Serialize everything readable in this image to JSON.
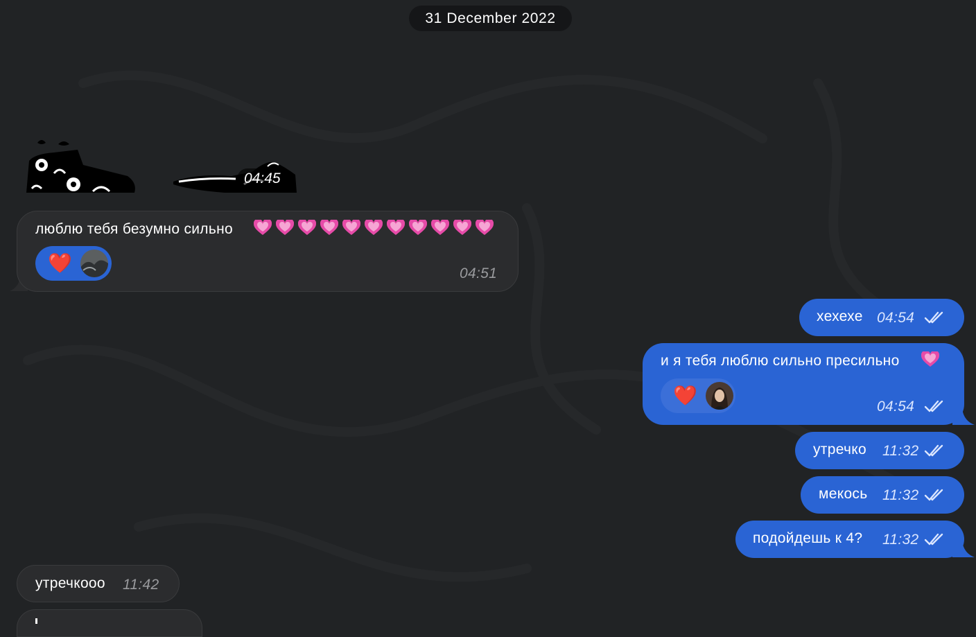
{
  "date_separator": "31 December 2022",
  "colors": {
    "background": "#212325",
    "incoming_bubble": "#2b2c2e",
    "outgoing_bubble": "#2a64d4",
    "reaction_pill_incoming": "#2a64d4",
    "reaction_pill_outgoing": "#3b6fd8",
    "heart": "#e8232e",
    "pink_heart": "#e64ba8"
  },
  "messages": [
    {
      "id": "m0",
      "direction": "in",
      "type": "sticker",
      "time": "04:45",
      "icon": "anime-sticker"
    },
    {
      "id": "m1",
      "direction": "in",
      "text": "люблю тебя безумно сильно",
      "emoji": "pink-heart",
      "emoji_count": 11,
      "reaction": "❤️",
      "time": "04:51"
    },
    {
      "id": "m2",
      "direction": "out",
      "text": "хехехе",
      "time": "04:54",
      "status": "read"
    },
    {
      "id": "m3",
      "direction": "out",
      "text": "и я тебя люблю сильно пресильно",
      "emoji": "pink-heart",
      "emoji_count": 1,
      "reaction": "❤️",
      "time": "04:54",
      "status": "read"
    },
    {
      "id": "m4",
      "direction": "out",
      "text": "утречко",
      "time": "11:32",
      "status": "read"
    },
    {
      "id": "m5",
      "direction": "out",
      "text": "мекось",
      "time": "11:32",
      "status": "read"
    },
    {
      "id": "m6",
      "direction": "out",
      "text": "подойдешь к 4?",
      "time": "11:32",
      "status": "read"
    },
    {
      "id": "m7",
      "direction": "in",
      "text": "утречкооо",
      "time": "11:42"
    }
  ]
}
